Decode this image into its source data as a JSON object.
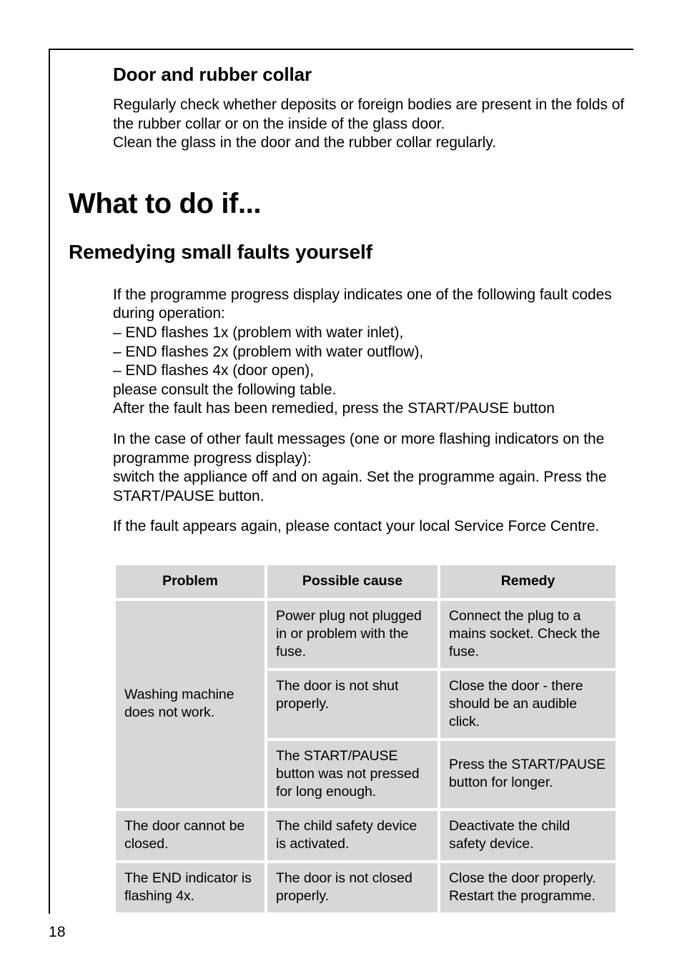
{
  "page": {
    "number": "18"
  },
  "sections": {
    "door_collar": {
      "heading": "Door and rubber collar",
      "paragraph": "Regularly check whether deposits or foreign bodies are present in the folds of the rubber collar or on the inside of the glass door.\nClean the glass in the door and the rubber collar regularly."
    },
    "chapter": {
      "heading": "What to do if..."
    },
    "remedying": {
      "heading": "Remedying small faults yourself",
      "paragraph_1": "If the programme progress display indicates one of the following fault codes during operation:\n– END flashes 1x (problem with water inlet),\n– END flashes 2x (problem with water outflow),\n– END flashes 4x (door open),\nplease consult the following table.\nAfter the fault has been remedied, press the START/PAUSE button",
      "paragraph_2": "In the case of other fault messages (one or more flashing indicators on the programme progress display):\nswitch the appliance off and on again. Set the programme again. Press the START/PAUSE button.",
      "paragraph_3": "If the fault appears again, please contact your local Service Force Centre."
    }
  },
  "fault_table": {
    "headers": {
      "problem": "Problem",
      "possible_cause": "Possible cause",
      "remedy": "Remedy"
    },
    "rows": [
      {
        "problem": "Washing machine does not work.",
        "cause": "Power plug not plugged in or problem with the fuse.",
        "remedy": "Connect the plug to a mains socket. Check the fuse."
      },
      {
        "cause": "The door is not shut properly.",
        "remedy": "Close the door - there should be an audible click."
      },
      {
        "cause": "The START/PAUSE button was not pressed for long enough.",
        "remedy": "Press the START/PAUSE button for longer."
      },
      {
        "problem": "The door cannot be closed.",
        "cause": "The child safety device is activated.",
        "remedy": "Deactivate the child safety device."
      },
      {
        "problem": "The END indicator is flashing 4x.",
        "cause": "The door is not closed properly.",
        "remedy": "Close the door properly. Restart the programme."
      }
    ]
  }
}
